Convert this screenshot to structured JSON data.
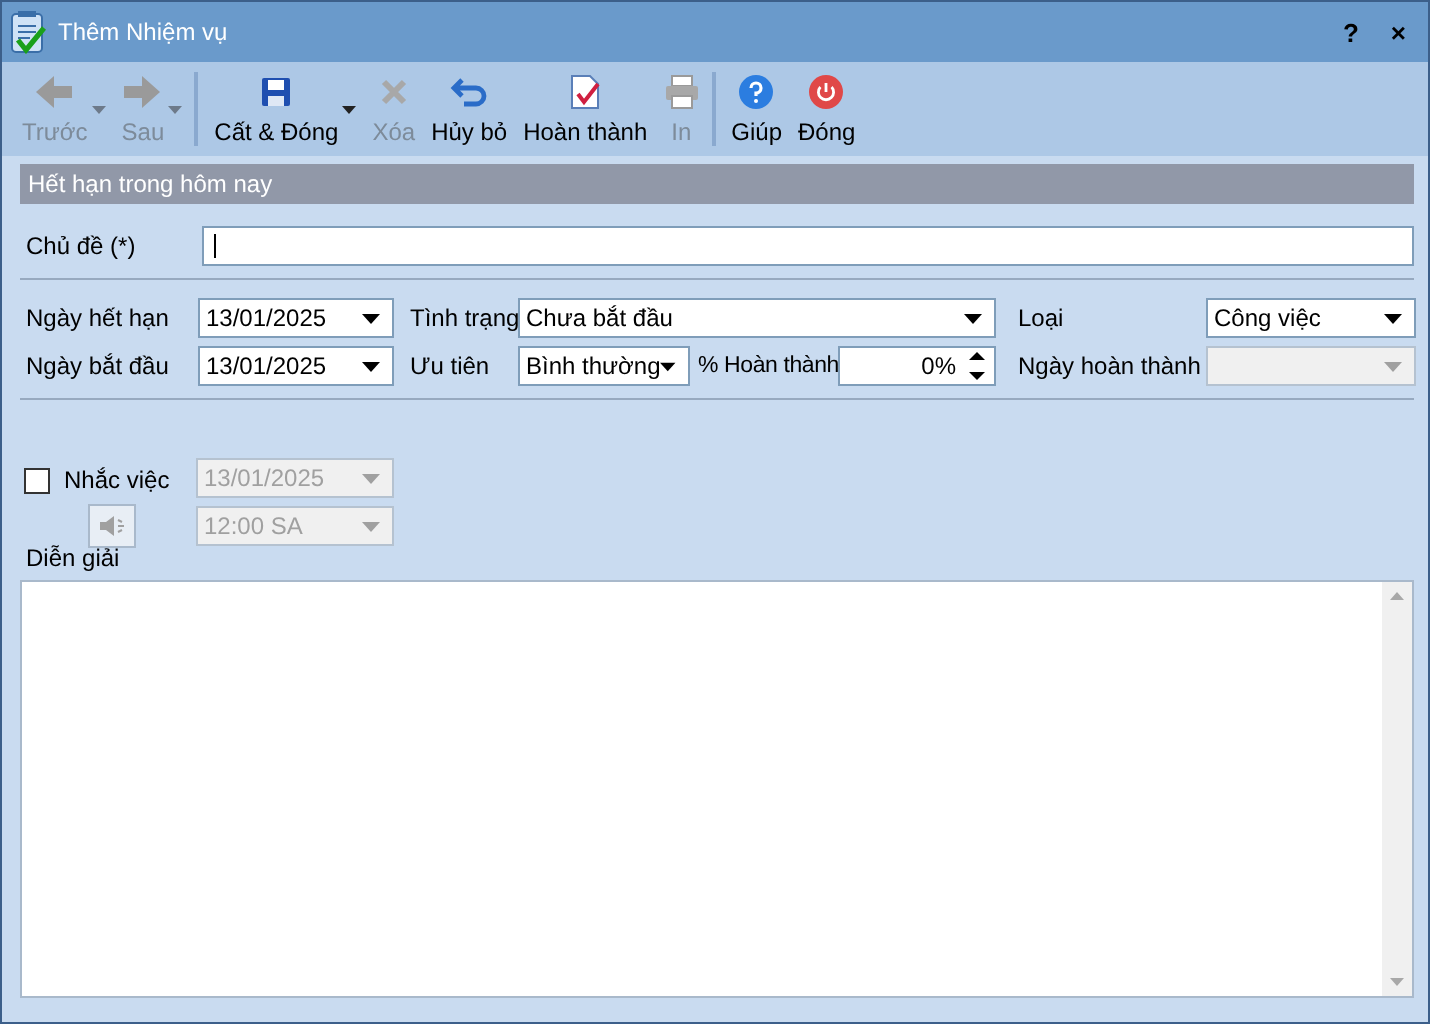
{
  "window": {
    "title": "Thêm Nhiệm vụ",
    "help": "?",
    "close": "×"
  },
  "toolbar": [
    {
      "kind": "back",
      "label": "Trước",
      "disabled": true,
      "dropdown": true,
      "separator_before": false
    },
    {
      "kind": "forward",
      "label": "Sau",
      "disabled": true,
      "dropdown": true,
      "separator_before": false
    },
    {
      "kind": "save",
      "label": "Cất & Đóng",
      "disabled": false,
      "dropdown": true,
      "separator_before": true
    },
    {
      "kind": "delete",
      "label": "Xóa",
      "disabled": true,
      "dropdown": false,
      "separator_before": false
    },
    {
      "kind": "undo",
      "label": "Hủy bỏ",
      "disabled": false,
      "dropdown": false,
      "separator_before": false
    },
    {
      "kind": "complete",
      "label": "Hoàn thành",
      "disabled": false,
      "dropdown": false,
      "separator_before": false
    },
    {
      "kind": "print",
      "label": "In",
      "disabled": true,
      "dropdown": false,
      "separator_before": false
    },
    {
      "kind": "help",
      "label": "Giúp",
      "disabled": false,
      "dropdown": false,
      "separator_before": true
    },
    {
      "kind": "power",
      "label": "Đóng",
      "disabled": false,
      "dropdown": false,
      "separator_before": false
    }
  ],
  "banner": "Hết hạn trong hôm nay",
  "subject": {
    "label": "Chủ đề (*)"
  },
  "due_date": {
    "label": "Ngày hết hạn",
    "value": "13/01/2025"
  },
  "status": {
    "label": "Tình trạng",
    "value": "Chưa bắt đầu"
  },
  "type": {
    "label": "Loại",
    "value": "Công việc"
  },
  "start_date": {
    "label": "Ngày bắt đầu",
    "value": "13/01/2025"
  },
  "priority": {
    "label": "Ưu tiên",
    "value": "Bình thường"
  },
  "percent": {
    "label": "% Hoàn thành",
    "value": "0%"
  },
  "completed_date": {
    "label": "Ngày hoàn thành",
    "disabled": true
  },
  "reminder": {
    "label": "Nhắc việc",
    "checked": false,
    "date": "13/01/2025",
    "time": "12:00 SA",
    "disabled": true
  },
  "description": {
    "label": "Diễn giải"
  }
}
